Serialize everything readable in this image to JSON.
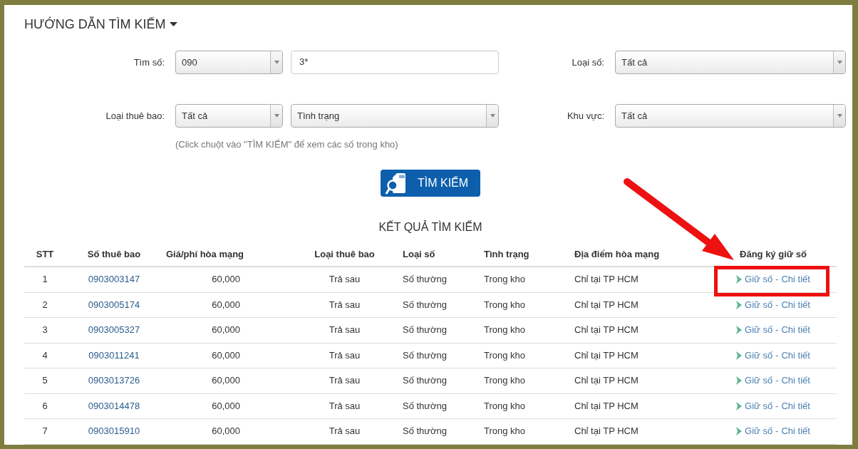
{
  "guide": {
    "title": "HƯỚNG DẪN TÌM KIẾM"
  },
  "form": {
    "rows": [
      {
        "fields": [
          {
            "label": "Tìm số:",
            "controls": [
              {
                "kind": "select",
                "value": "090"
              },
              {
                "kind": "input",
                "value": "3*"
              }
            ]
          },
          {
            "label": "Loại số:",
            "controls": [
              {
                "kind": "select",
                "value": "Tất cả"
              }
            ]
          }
        ]
      },
      {
        "fields": [
          {
            "label": "Loại thuê bao:",
            "controls": [
              {
                "kind": "select",
                "value": "Tất cả"
              },
              {
                "kind": "select",
                "value": "Tình trạng"
              }
            ]
          },
          {
            "label": "Khu vực:",
            "controls": [
              {
                "kind": "select",
                "value": "Tất cả"
              }
            ]
          }
        ]
      }
    ],
    "hint": "(Click chuột vào \"TÌM KIẾM\" để xem các số trong kho)",
    "search_button": "TÌM KIẾM"
  },
  "results": {
    "title": "KẾT QUẢ TÌM KIẾM",
    "columns": [
      "STT",
      "Số thuê bao",
      "Giá/phí hòa mạng",
      "Loại thuê bao",
      "Loại số",
      "Tình trạng",
      "Địa điểm hòa mạng",
      "Đăng ký giữ số"
    ],
    "rows": [
      {
        "stt": "1",
        "number": "0903003147",
        "price": "60,000",
        "subscription": "Trả sau",
        "number_type": "Số thường",
        "status": "Trong kho",
        "location": "Chỉ tại TP HCM",
        "actions": {
          "hold": "Giữ số",
          "separator": "-",
          "details": "Chi tiết"
        },
        "highlighted": true
      },
      {
        "stt": "2",
        "number": "0903005174",
        "price": "60,000",
        "subscription": "Trả sau",
        "number_type": "Số thường",
        "status": "Trong kho",
        "location": "Chỉ tại TP HCM",
        "actions": {
          "hold": "Giữ số",
          "separator": "-",
          "details": "Chi tiết"
        },
        "highlighted": false
      },
      {
        "stt": "3",
        "number": "0903005327",
        "price": "60,000",
        "subscription": "Trả sau",
        "number_type": "Số thường",
        "status": "Trong kho",
        "location": "Chỉ tại TP HCM",
        "actions": {
          "hold": "Giữ số",
          "separator": "-",
          "details": "Chi tiết"
        },
        "highlighted": false
      },
      {
        "stt": "4",
        "number": "0903011241",
        "price": "60,000",
        "subscription": "Trả sau",
        "number_type": "Số thường",
        "status": "Trong kho",
        "location": "Chỉ tại TP HCM",
        "actions": {
          "hold": "Giữ số",
          "separator": "-",
          "details": "Chi tiết"
        },
        "highlighted": false
      },
      {
        "stt": "5",
        "number": "0903013726",
        "price": "60,000",
        "subscription": "Trả sau",
        "number_type": "Số thường",
        "status": "Trong kho",
        "location": "Chỉ tại TP HCM",
        "actions": {
          "hold": "Giữ số",
          "separator": "-",
          "details": "Chi tiết"
        },
        "highlighted": false
      },
      {
        "stt": "6",
        "number": "0903014478",
        "price": "60,000",
        "subscription": "Trả sau",
        "number_type": "Số thường",
        "status": "Trong kho",
        "location": "Chỉ tại TP HCM",
        "actions": {
          "hold": "Giữ số",
          "separator": "-",
          "details": "Chi tiết"
        },
        "highlighted": false
      },
      {
        "stt": "7",
        "number": "0903015910",
        "price": "60,000",
        "subscription": "Trả sau",
        "number_type": "Số thường",
        "status": "Trong kho",
        "location": "Chỉ tại TP HCM",
        "actions": {
          "hold": "Giữ số",
          "separator": "-",
          "details": "Chi tiết"
        },
        "highlighted": false
      }
    ]
  }
}
